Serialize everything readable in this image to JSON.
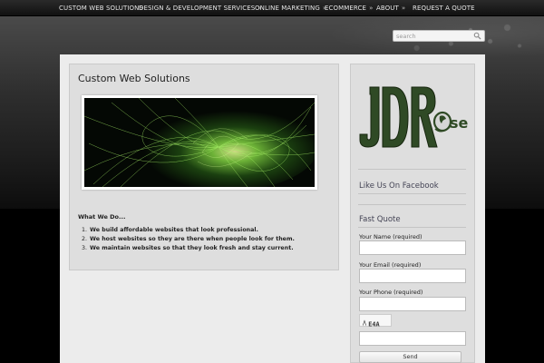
{
  "nav": {
    "items": [
      {
        "label": "CUSTOM WEB SOLUTIONS",
        "caret": ""
      },
      {
        "label": "DESIGN & DEVELOPMENT SERVICES",
        "caret": "»"
      },
      {
        "label": "ONLINE MARKETING",
        "caret": "»"
      },
      {
        "label": "ECOMMERCE",
        "caret": "»"
      },
      {
        "label": "ABOUT",
        "caret": "»"
      },
      {
        "label": "REQUEST A QUOTE",
        "caret": ""
      }
    ]
  },
  "search": {
    "placeholder": "search"
  },
  "main": {
    "title": "Custom Web Solutions",
    "section_heading": "What We Do...",
    "items": [
      {
        "num": "1.",
        "text": "We build affordable websites that look professional."
      },
      {
        "num": "2.",
        "text": "We host websites so they are there when people look for them."
      },
      {
        "num": "3.",
        "text": "We maintain websites so that they look fresh and stay current."
      }
    ]
  },
  "sidebar": {
    "logo_text": "JDRose",
    "facebook_heading": "Like Us On Facebook",
    "quote_heading": "Fast Quote",
    "name_label": "Your Name (required)",
    "email_label": "Your Email (required)",
    "phone_label": "Your Phone (required)",
    "captcha_text": "E4A",
    "send_label": "Send"
  },
  "colors": {
    "logo_green": "#2f4a25",
    "hero_green": "#9be05a"
  }
}
